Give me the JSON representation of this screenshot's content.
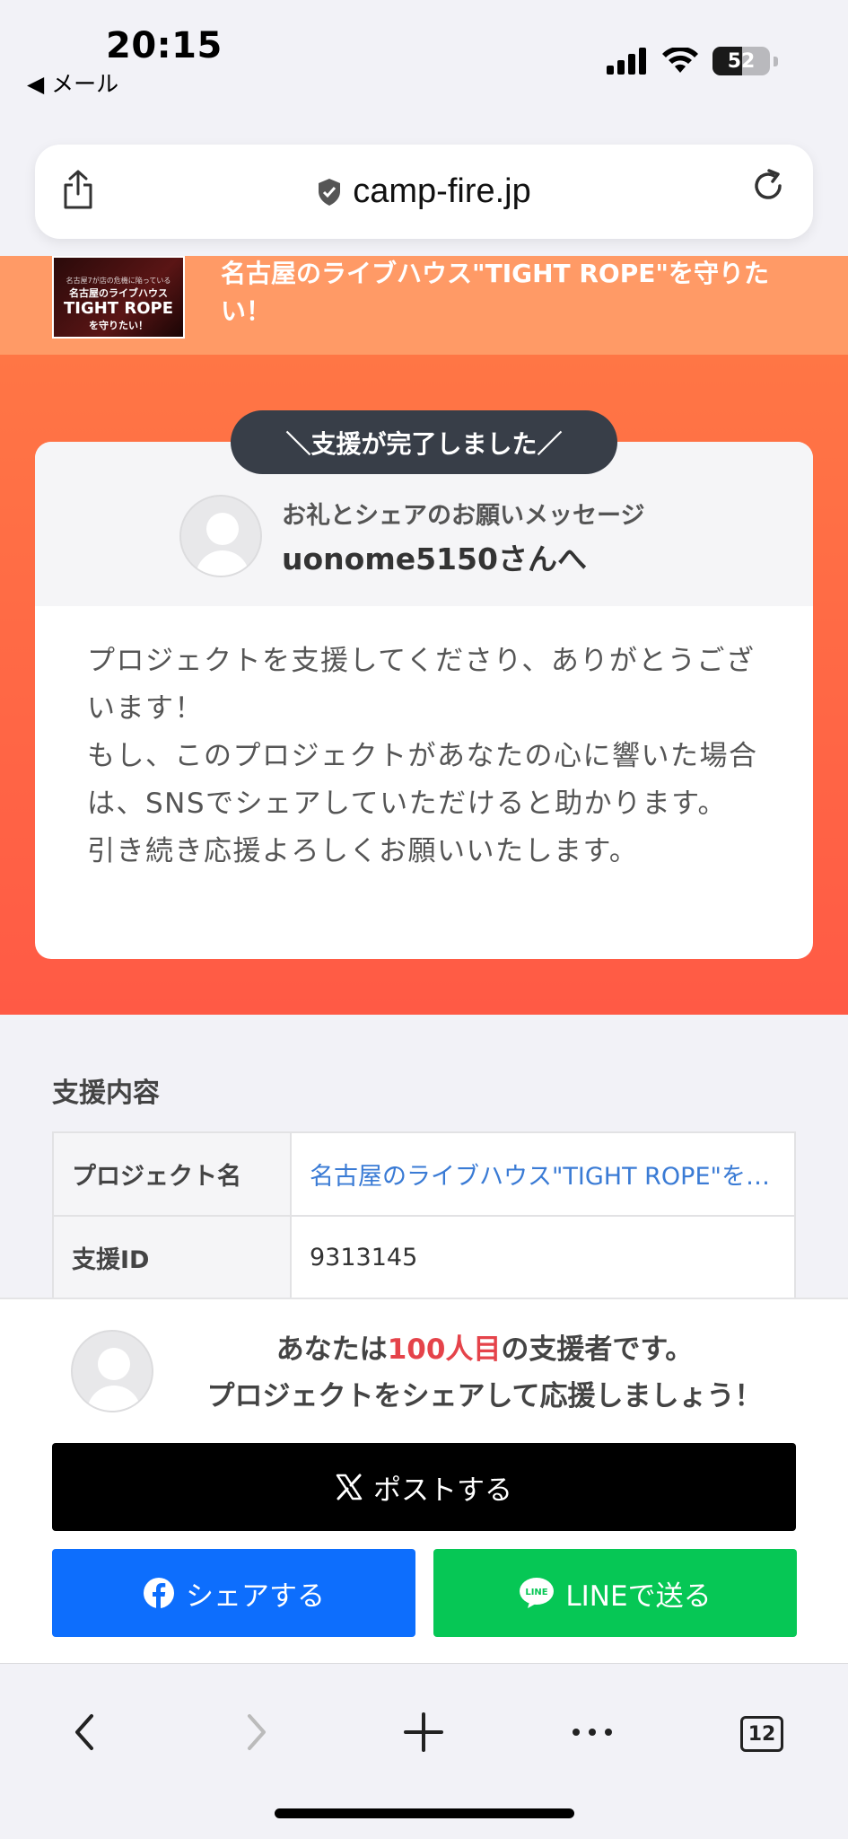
{
  "status_bar": {
    "time": "20:15",
    "back_label": "◀ メール",
    "battery_level": "52",
    "battery_fraction": 0.52
  },
  "browser": {
    "url": "camp-fire.jp",
    "tab_count": "12",
    "icons": [
      "share-icon",
      "shield-icon",
      "reload-icon",
      "back-chevron-icon",
      "forward-chevron-icon",
      "new-tab-icon",
      "more-icon",
      "tabs-icon"
    ]
  },
  "project": {
    "title": "名古屋のライブハウス\"TIGHT ROPE\"を守りたい！",
    "thumb_line1": "名古屋7が店の危機に陥っている",
    "thumb_line2": "名古屋のライブハウス",
    "thumb_line3": "TIGHT ROPE",
    "thumb_line4": "を守りたい！"
  },
  "card": {
    "done_label": "＼支援が完了しました／",
    "message_label": "お礼とシェアのお願いメッセージ",
    "recipient": "uonome5150さんへ",
    "body": "プロジェクトを支援してくださり、ありがとうございます！\nもし、このプロジェクトがあなたの心に響いた場合は、SNSでシェアしていただけると助かります。\n引き続き応援よろしくお願いいたします。"
  },
  "support": {
    "section_title": "支援内容",
    "rows": [
      {
        "key": "プロジェクト名",
        "value": "名古屋のライブハウス\"TIGHT ROPE\"を守りたい！"
      },
      {
        "key": "支援ID",
        "value": "9313145"
      }
    ]
  },
  "share": {
    "line1_prefix": "あなたは",
    "line1_count": "100人目",
    "line1_suffix": "の支援者です。",
    "line2": "プロジェクトをシェアして応援しましょう！",
    "post_label": "ポストする",
    "facebook_label": "シェアする",
    "line_label": "LINEで送る",
    "line_logo_text": "LINE"
  },
  "colors": {
    "header_orange": "#ff7a45",
    "accent_red": "#e5434a",
    "x_button": "#000000",
    "facebook_button": "#0d6efd",
    "line_button": "#06c755",
    "link": "#3a7bd5"
  }
}
